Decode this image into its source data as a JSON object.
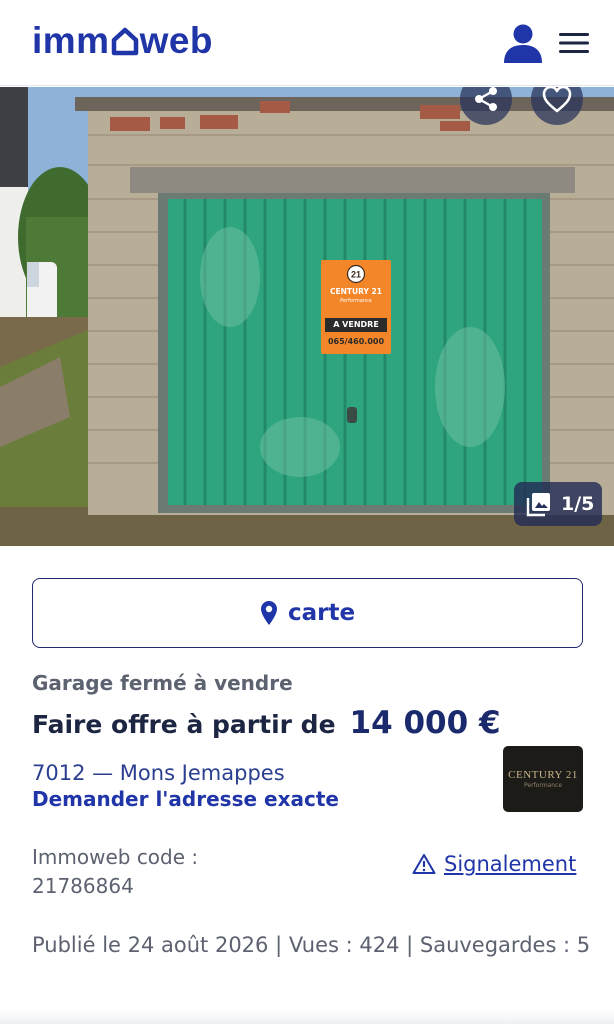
{
  "header": {
    "logo_left": "imm",
    "logo_right": "web",
    "brand_color": "#1f35a8",
    "icons": [
      "user-icon",
      "hamburger-menu-icon"
    ]
  },
  "gallery": {
    "counter": "1/5",
    "poster": {
      "brand": "CENTURY 21",
      "office": "Performance",
      "label": "A VENDRE",
      "phone": "065/460.000"
    },
    "icons": [
      "share-icon",
      "heart-icon",
      "photo-gallery-icon"
    ]
  },
  "map_button": {
    "label": "carte",
    "icon": "location-pin-icon"
  },
  "listing": {
    "subtype": "Garage fermé à vendre",
    "price_prefix": "Faire offre à partir de",
    "price": "14 000 €",
    "location": "7012 — Mons Jemappes",
    "address_link": "Demander l'adresse exacte"
  },
  "agency": {
    "name": "CENTURY 21",
    "office": "Performance"
  },
  "meta": {
    "code_label": "Immoweb code :",
    "code_value": "21786864",
    "report_label": "Signalement",
    "published": "Publié le 24 août 2026 | Vues : 424 | Sauvegardes : 5"
  }
}
